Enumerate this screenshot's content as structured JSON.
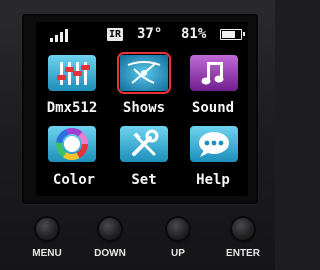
{
  "status": {
    "signal_icon": "signal-bars-icon",
    "ir_label": "IR",
    "temperature": "37°",
    "battery_percent": "81%",
    "battery_level": 0.81
  },
  "menu": {
    "items": [
      {
        "label": "Dmx512",
        "icon": "faders-icon",
        "color": "#2fb4d6"
      },
      {
        "label": "Shows",
        "icon": "swirl-icon",
        "color": "#1f9ec9",
        "selected": true
      },
      {
        "label": "Sound",
        "icon": "music-note-icon",
        "color": "#9a3fb3"
      },
      {
        "label": "Color",
        "icon": "color-wheel-icon",
        "color": "#2fb4d6"
      },
      {
        "label": "Set",
        "icon": "wrench-screwdriver-icon",
        "color": "#2fb4d6"
      },
      {
        "label": "Help",
        "icon": "chat-bubble-icon",
        "color": "#2fb4d6"
      }
    ]
  },
  "buttons": {
    "menu": "MENU",
    "down": "DOWN",
    "up": "UP",
    "enter": "ENTER"
  },
  "colors": {
    "selection": "#e8323a",
    "screen_bg": "#000000",
    "device_body": "#1d1d1f"
  }
}
